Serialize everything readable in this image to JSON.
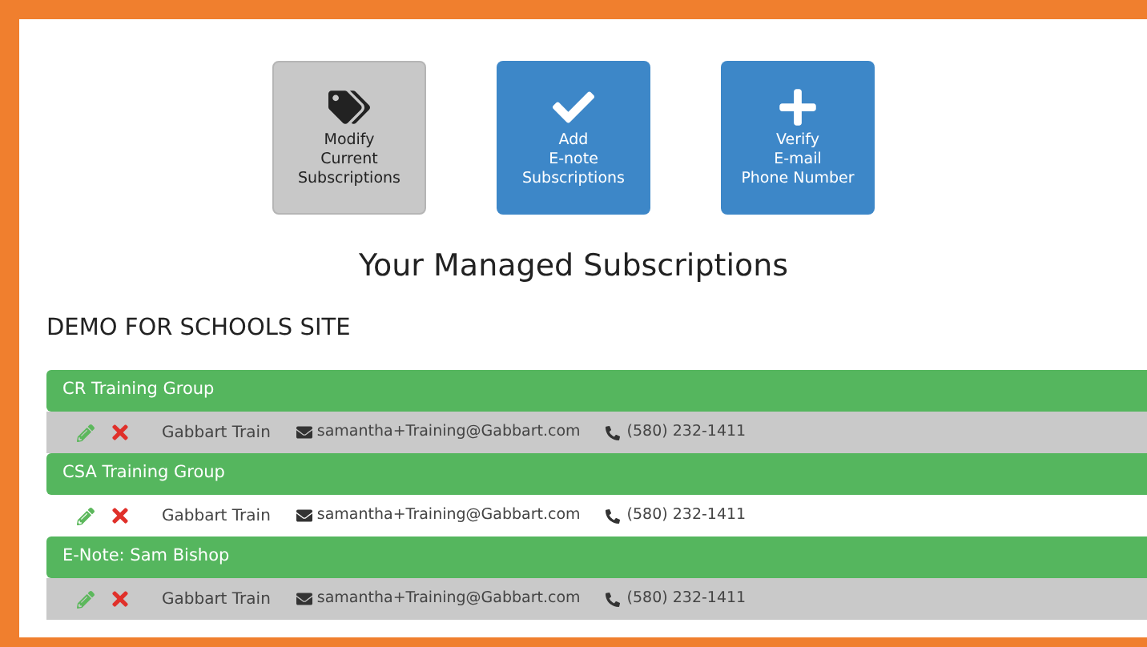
{
  "actions": [
    {
      "kind": "tags",
      "lines": [
        "Modify",
        "Current",
        "Subscriptions"
      ],
      "selected": true
    },
    {
      "kind": "check",
      "lines": [
        "Add",
        "E-note",
        "Subscriptions"
      ],
      "selected": false
    },
    {
      "kind": "plus",
      "lines": [
        "Verify",
        "E-mail",
        "Phone Number"
      ],
      "selected": false
    }
  ],
  "title": "Your Managed Subscriptions",
  "site": "DEMO FOR SCHOOLS SITE",
  "groups": [
    {
      "name": "CR Training Group",
      "contact": {
        "name": "Gabbart Train",
        "email": "samantha+Training@Gabbart.com",
        "phone": "(580) 232-1411"
      }
    },
    {
      "name": "CSA Training Group",
      "contact": {
        "name": "Gabbart Train",
        "email": "samantha+Training@Gabbart.com",
        "phone": "(580) 232-1411"
      }
    },
    {
      "name": "E-Note: Sam Bishop",
      "contact": {
        "name": "Gabbart Train",
        "email": "samantha+Training@Gabbart.com",
        "phone": "(580) 232-1411"
      }
    }
  ]
}
